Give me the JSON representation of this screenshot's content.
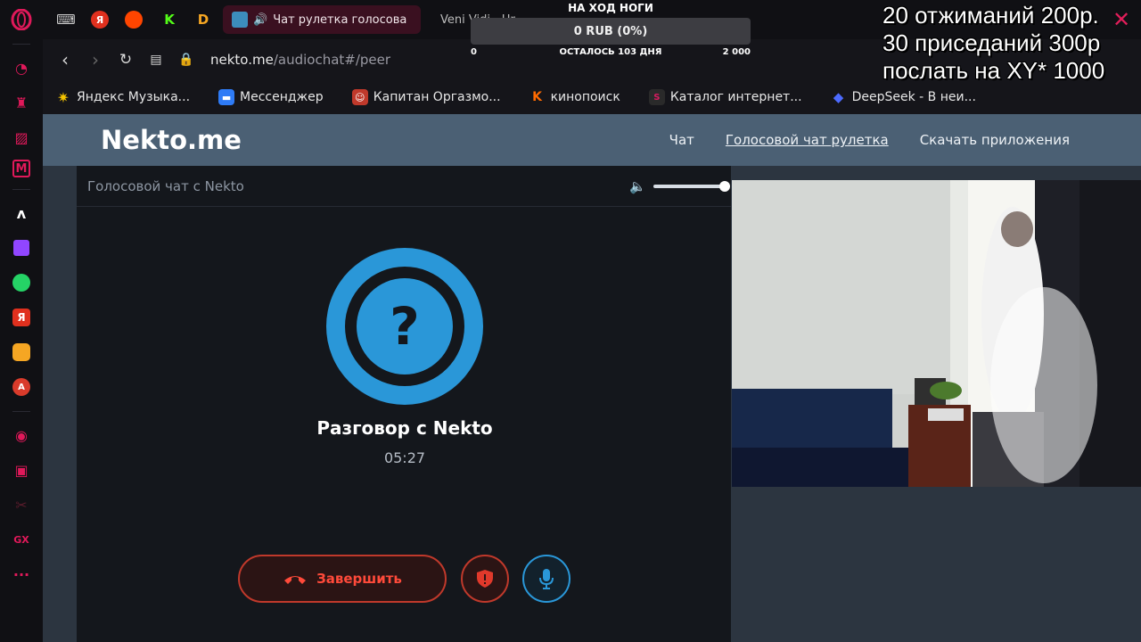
{
  "browser": {
    "active_tab_title": "Чат рулетка голосова",
    "second_tab_title": "Veni Vidi - Universe Inside",
    "url_host": "nekto.me",
    "url_path": "/audiochat#/peer"
  },
  "bookmarks": [
    {
      "label": "Яндекс Музыка...",
      "icon": "yandex-music-icon",
      "color": "#f5c400"
    },
    {
      "label": "Мессенджер",
      "icon": "messenger-icon",
      "color": "#2e7bf6"
    },
    {
      "label": "Капитан Оргазмо...",
      "icon": "face-icon",
      "color": "#c0392b"
    },
    {
      "label": "кинопоиск",
      "icon": "kinopoisk-icon",
      "color": "#ff6a00"
    },
    {
      "label": "Каталог интернет...",
      "icon": "catalog-icon",
      "color": "#d81b60"
    },
    {
      "label": "DeepSeek - В неи...",
      "icon": "deepseek-icon",
      "color": "#4d6bfe"
    }
  ],
  "donation_bar": {
    "title": "НА ХОД НОГИ",
    "amount": "0 RUB (0%)",
    "min": "0",
    "remaining": "ОСТАЛОСЬ 103 ДНЯ",
    "max": "2 000"
  },
  "overlay": {
    "line1": "20 отжиманий 200р.",
    "line2": "30 приседаний 300р",
    "line3": "послать на XY* 1000"
  },
  "site": {
    "logo": "Nekto.me",
    "nav": [
      "Чат",
      "Голосовой чат рулетка",
      "Скачать приложения"
    ]
  },
  "chat": {
    "header": "Голосовой чат с Nekto",
    "volume": 1.0,
    "title": "Разговор с Nekto",
    "timer": "05:27",
    "end_label": "Завершить",
    "accent": "#2a97d8",
    "danger": "#e0392b"
  }
}
